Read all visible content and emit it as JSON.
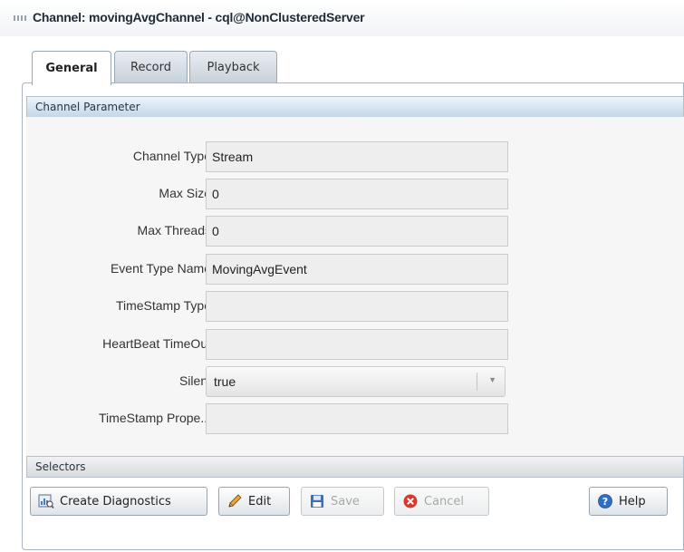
{
  "window": {
    "title": "Channel: movingAvgChannel - cql@NonClusteredServer"
  },
  "tabs": [
    {
      "label": "General",
      "active": true
    },
    {
      "label": "Record",
      "active": false
    },
    {
      "label": "Playback",
      "active": false
    }
  ],
  "sections": {
    "channel_parameter": "Channel Parameter",
    "selectors": "Selectors"
  },
  "fields": {
    "channel_type": {
      "label": "Channel Type",
      "value": "Stream"
    },
    "max_size": {
      "label": "Max Size",
      "value": "0"
    },
    "max_threads": {
      "label": "Max Threads",
      "value": "0"
    },
    "event_type_name": {
      "label": "Event Type Name",
      "value": "MovingAvgEvent"
    },
    "timestamp_type": {
      "label": "TimeStamp Type",
      "value": ""
    },
    "heartbeat_timeout": {
      "label": "HeartBeat TimeOut",
      "value": ""
    },
    "silent": {
      "label": "Silent",
      "value": "true"
    },
    "timestamp_property": {
      "label": "TimeStamp Prope...",
      "value": ""
    }
  },
  "buttons": {
    "create_diagnostics": "Create Diagnostics",
    "edit": "Edit",
    "save": "Save",
    "cancel": "Cancel",
    "help": "Help"
  },
  "icons": {
    "create_diagnostics": "diagnostics-icon",
    "edit": "pencil-icon",
    "save": "floppy-disk-icon",
    "cancel": "cancel-x-icon",
    "help": "help-question-icon"
  },
  "colors": {
    "section_header_blue": "#c3d6e8",
    "cancel_red": "#d9382f",
    "help_blue": "#2f6fc4",
    "save_blue": "#3f6fb0"
  }
}
